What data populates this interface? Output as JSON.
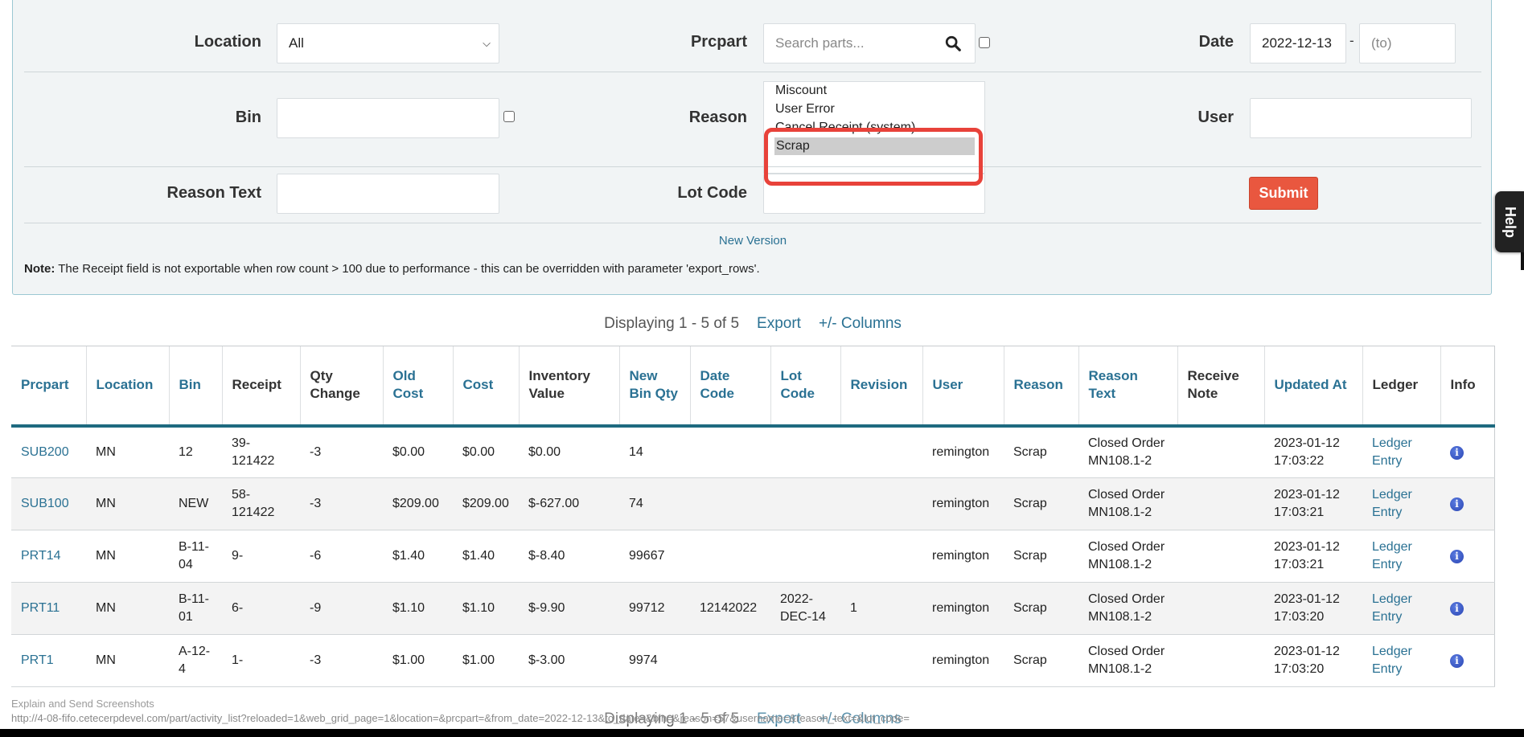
{
  "filters": {
    "location": {
      "label": "Location",
      "value": "All"
    },
    "prcpart": {
      "label": "Prcpart",
      "placeholder": "Search parts..."
    },
    "date": {
      "label": "Date",
      "from_value": "2022-12-13",
      "separator": "-",
      "to_placeholder": "(to)"
    },
    "bin": {
      "label": "Bin",
      "value": ""
    },
    "reason": {
      "label": "Reason",
      "options": [
        "Miscount",
        "User Error",
        "Cancel Receipt (system)",
        "Scrap"
      ],
      "selected": "Scrap"
    },
    "user": {
      "label": "User",
      "value": ""
    },
    "reason_text": {
      "label": "Reason Text",
      "value": ""
    },
    "lot_code": {
      "label": "Lot Code",
      "value": ""
    },
    "submit_label": "Submit"
  },
  "new_version_label": "New Version",
  "note": {
    "bold": "Note:",
    "text": " The Receipt field is not exportable when row count > 100 due to performance - this can be overridden with parameter 'export_rows'."
  },
  "pagination": {
    "displaying": "Displaying 1 - 5 of 5",
    "export_label": "Export",
    "columns_label": "+/- Columns"
  },
  "table": {
    "columns": [
      {
        "label": "Prcpart",
        "sortable": true
      },
      {
        "label": "Location",
        "sortable": true
      },
      {
        "label": "Bin",
        "sortable": true
      },
      {
        "label": "Receipt",
        "sortable": false
      },
      {
        "label": "Qty Change",
        "sortable": false
      },
      {
        "label": "Old Cost",
        "sortable": true
      },
      {
        "label": "Cost",
        "sortable": true
      },
      {
        "label": "Inventory Value",
        "sortable": false
      },
      {
        "label": "New Bin Qty",
        "sortable": true
      },
      {
        "label": "Date Code",
        "sortable": true
      },
      {
        "label": "Lot Code",
        "sortable": true
      },
      {
        "label": "Revision",
        "sortable": true
      },
      {
        "label": "User",
        "sortable": true
      },
      {
        "label": "Reason",
        "sortable": true
      },
      {
        "label": "Reason Text",
        "sortable": true
      },
      {
        "label": "Receive Note",
        "sortable": false
      },
      {
        "label": "Updated At",
        "sortable": true
      },
      {
        "label": "Ledger",
        "sortable": false
      },
      {
        "label": "Info",
        "sortable": false
      }
    ],
    "rows": [
      {
        "prcpart": "SUB200",
        "location": "MN",
        "bin": "12",
        "receipt": "39-121422",
        "qty_change": "-3",
        "old_cost": "$0.00",
        "cost": "$0.00",
        "inventory_value": "$0.00",
        "new_bin_qty": "14",
        "date_code": "",
        "lot_code": "",
        "revision": "",
        "user": "remington",
        "reason": "Scrap",
        "reason_text": "Closed Order MN108.1-2",
        "receive_note": "",
        "updated_at": "2023-01-12 17:03:22",
        "ledger": "Ledger Entry",
        "info": "info-icon"
      },
      {
        "prcpart": "SUB100",
        "location": "MN",
        "bin": "NEW",
        "receipt": "58-121422",
        "qty_change": "-3",
        "old_cost": "$209.00",
        "cost": "$209.00",
        "inventory_value": "$-627.00",
        "new_bin_qty": "74",
        "date_code": "",
        "lot_code": "",
        "revision": "",
        "user": "remington",
        "reason": "Scrap",
        "reason_text": "Closed Order MN108.1-2",
        "receive_note": "",
        "updated_at": "2023-01-12 17:03:21",
        "ledger": "Ledger Entry",
        "info": "info-icon"
      },
      {
        "prcpart": "PRT14",
        "location": "MN",
        "bin": "B-11-04",
        "receipt": "9-",
        "qty_change": "-6",
        "old_cost": "$1.40",
        "cost": "$1.40",
        "inventory_value": "$-8.40",
        "new_bin_qty": "99667",
        "date_code": "",
        "lot_code": "",
        "revision": "",
        "user": "remington",
        "reason": "Scrap",
        "reason_text": "Closed Order MN108.1-2",
        "receive_note": "",
        "updated_at": "2023-01-12 17:03:21",
        "ledger": "Ledger Entry",
        "info": "info-icon"
      },
      {
        "prcpart": "PRT11",
        "location": "MN",
        "bin": "B-11-01",
        "receipt": "6-",
        "qty_change": "-9",
        "old_cost": "$1.10",
        "cost": "$1.10",
        "inventory_value": "$-9.90",
        "new_bin_qty": "99712",
        "date_code": "12142022",
        "lot_code": "2022-DEC-14",
        "revision": "1",
        "user": "remington",
        "reason": "Scrap",
        "reason_text": "Closed Order MN108.1-2",
        "receive_note": "",
        "updated_at": "2023-01-12 17:03:20",
        "ledger": "Ledger Entry",
        "info": "info-icon"
      },
      {
        "prcpart": "PRT1",
        "location": "MN",
        "bin": "A-12-4",
        "receipt": "1-",
        "qty_change": "-3",
        "old_cost": "$1.00",
        "cost": "$1.00",
        "inventory_value": "$-3.00",
        "new_bin_qty": "9974",
        "date_code": "",
        "lot_code": "",
        "revision": "",
        "user": "remington",
        "reason": "Scrap",
        "reason_text": "Closed Order MN108.1-2",
        "receive_note": "",
        "updated_at": "2023-01-12 17:03:20",
        "ledger": "Ledger Entry",
        "info": "info-icon"
      }
    ]
  },
  "help_label": "Help",
  "status_bar": {
    "line1": "Explain and Send Screenshots",
    "url": "http://4-08-fifo.cetecerpdevel.com/part/activity_list?reloaded=1&web_grid_page=1&location=&prcpart=&from_date=2022-12-13&to_date=&bin=&reason=57&username=&reason_text=&lot_code="
  },
  "colors": {
    "link": "#2a7193",
    "header_border": "#1e6a80",
    "submit": "#e9573f",
    "annotation": "#e8423a",
    "panel_bg": "#f1f4f5"
  }
}
